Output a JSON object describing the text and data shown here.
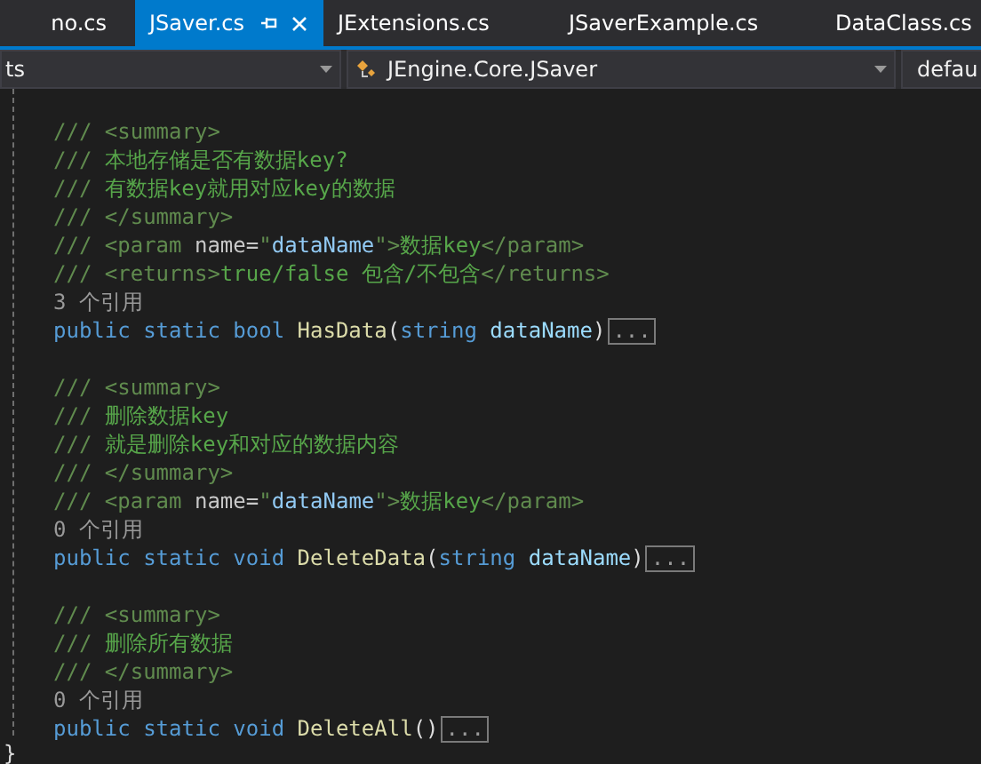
{
  "tabs": [
    {
      "label": "no.cs",
      "selected": false
    },
    {
      "label": "JSaver.cs",
      "selected": true
    },
    {
      "label": "JExtensions.cs",
      "selected": false
    },
    {
      "label": "JSaverExample.cs",
      "selected": false
    },
    {
      "label": "DataClass.cs",
      "selected": false
    }
  ],
  "nav_bar": [
    {
      "value": "ts",
      "kind": "project"
    },
    {
      "value": "JEngine.Core.JSaver",
      "kind": "class"
    },
    {
      "value": "defau",
      "kind": "member"
    }
  ],
  "code": {
    "closing_brace": "}",
    "lines": [
      {
        "kind": "blank"
      },
      {
        "kind": "comment",
        "segments": [
          {
            "kind": "doc",
            "text": "/// <summary>"
          }
        ]
      },
      {
        "kind": "comment",
        "segments": [
          {
            "kind": "doc",
            "text": "/// "
          },
          {
            "kind": "text",
            "text": "本地存储是否有数据key?"
          }
        ]
      },
      {
        "kind": "comment",
        "segments": [
          {
            "kind": "doc",
            "text": "/// "
          },
          {
            "kind": "text",
            "text": "有数据key就用对应key的数据"
          }
        ]
      },
      {
        "kind": "comment",
        "segments": [
          {
            "kind": "doc",
            "text": "/// </summary>"
          }
        ]
      },
      {
        "kind": "comment",
        "segments": [
          {
            "kind": "doc",
            "text": "/// <param "
          },
          {
            "kind": "attr",
            "text": "name="
          },
          {
            "kind": "doc",
            "text": "\""
          },
          {
            "kind": "value",
            "text": "dataName"
          },
          {
            "kind": "doc",
            "text": "\">"
          },
          {
            "kind": "text",
            "text": "数据key"
          },
          {
            "kind": "doc",
            "text": "</param>"
          }
        ]
      },
      {
        "kind": "comment",
        "segments": [
          {
            "kind": "doc",
            "text": "/// <returns>"
          },
          {
            "kind": "text",
            "text": "true/false 包含/不包含"
          },
          {
            "kind": "doc",
            "text": "</returns>"
          }
        ]
      },
      {
        "kind": "refs",
        "text": "3 个引用"
      },
      {
        "kind": "code",
        "collapsed": "...",
        "segments": [
          {
            "kind": "keyword",
            "text": "public static bool "
          },
          {
            "kind": "method",
            "text": "HasData"
          },
          {
            "kind": "plain",
            "text": "("
          },
          {
            "kind": "keyword",
            "text": "string "
          },
          {
            "kind": "param",
            "text": "dataName"
          },
          {
            "kind": "plain",
            "text": ")"
          }
        ]
      },
      {
        "kind": "blank"
      },
      {
        "kind": "comment",
        "segments": [
          {
            "kind": "doc",
            "text": "/// <summary>"
          }
        ]
      },
      {
        "kind": "comment",
        "segments": [
          {
            "kind": "doc",
            "text": "/// "
          },
          {
            "kind": "text",
            "text": "删除数据key"
          }
        ]
      },
      {
        "kind": "comment",
        "segments": [
          {
            "kind": "doc",
            "text": "/// "
          },
          {
            "kind": "text",
            "text": "就是删除key和对应的数据内容"
          }
        ]
      },
      {
        "kind": "comment",
        "segments": [
          {
            "kind": "doc",
            "text": "/// </summary>"
          }
        ]
      },
      {
        "kind": "comment",
        "segments": [
          {
            "kind": "doc",
            "text": "/// <param "
          },
          {
            "kind": "attr",
            "text": "name="
          },
          {
            "kind": "doc",
            "text": "\""
          },
          {
            "kind": "value",
            "text": "dataName"
          },
          {
            "kind": "doc",
            "text": "\">"
          },
          {
            "kind": "text",
            "text": "数据key"
          },
          {
            "kind": "doc",
            "text": "</param>"
          }
        ]
      },
      {
        "kind": "refs",
        "text": "0 个引用"
      },
      {
        "kind": "code",
        "collapsed": "...",
        "segments": [
          {
            "kind": "keyword",
            "text": "public static void "
          },
          {
            "kind": "method",
            "text": "DeleteData"
          },
          {
            "kind": "plain",
            "text": "("
          },
          {
            "kind": "keyword",
            "text": "string "
          },
          {
            "kind": "param",
            "text": "dataName"
          },
          {
            "kind": "plain",
            "text": ")"
          }
        ]
      },
      {
        "kind": "blank"
      },
      {
        "kind": "comment",
        "segments": [
          {
            "kind": "doc",
            "text": "/// <summary>"
          }
        ]
      },
      {
        "kind": "comment",
        "segments": [
          {
            "kind": "doc",
            "text": "/// "
          },
          {
            "kind": "text",
            "text": "删除所有数据"
          }
        ]
      },
      {
        "kind": "comment",
        "segments": [
          {
            "kind": "doc",
            "text": "/// </summary>"
          }
        ]
      },
      {
        "kind": "refs",
        "text": "0 个引用"
      },
      {
        "kind": "code",
        "collapsed": "...",
        "segments": [
          {
            "kind": "keyword",
            "text": "public static void "
          },
          {
            "kind": "method",
            "text": "DeleteAll"
          },
          {
            "kind": "plain",
            "text": "()"
          }
        ]
      }
    ]
  }
}
